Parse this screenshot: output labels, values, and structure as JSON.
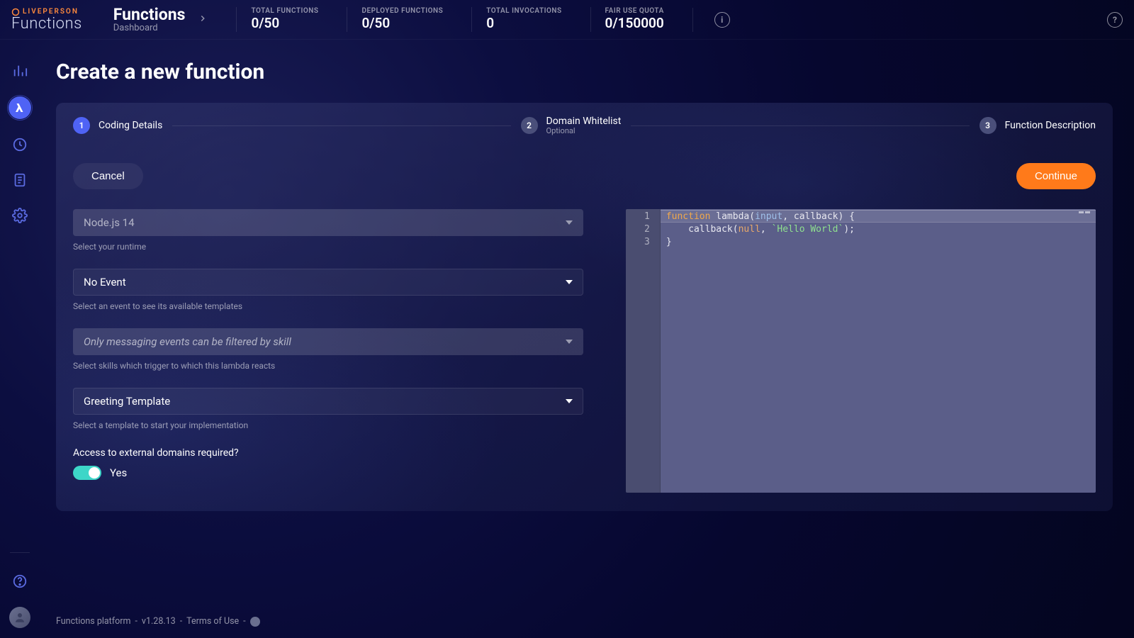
{
  "brand": {
    "lp": "LIVEPERSON",
    "fn": "Functions"
  },
  "breadcrumb": {
    "title": "Functions",
    "subtitle": "Dashboard"
  },
  "stats": {
    "total_functions": {
      "label": "TOTAL FUNCTIONS",
      "value": "0/50"
    },
    "deployed_functions": {
      "label": "DEPLOYED FUNCTIONS",
      "value": "0/50"
    },
    "total_invocations": {
      "label": "TOTAL INVOCATIONS",
      "value": "0"
    },
    "fair_use_quota": {
      "label": "FAIR USE QUOTA",
      "value": "0/150000"
    }
  },
  "page": {
    "title": "Create a new function"
  },
  "stepper": {
    "s1": {
      "num": "1",
      "title": "Coding Details"
    },
    "s2": {
      "num": "2",
      "title": "Domain Whitelist",
      "sub": "Optional"
    },
    "s3": {
      "num": "3",
      "title": "Function Description"
    }
  },
  "actions": {
    "cancel": "Cancel",
    "continue": "Continue"
  },
  "form": {
    "runtime": {
      "value": "Node.js 14",
      "helper": "Select your runtime"
    },
    "event": {
      "value": "No Event",
      "helper": "Select an event to see its available templates"
    },
    "skills": {
      "placeholder": "Only messaging events can be filtered by skill",
      "helper": "Select skills which trigger to which this lambda reacts"
    },
    "template": {
      "value": "Greeting Template",
      "helper": "Select a template to start your implementation"
    },
    "external": {
      "label": "Access to external domains required?",
      "value": "Yes"
    }
  },
  "code": {
    "gutter": [
      "1",
      "2",
      "3"
    ],
    "l1": {
      "kw": "function",
      "fn": " lambda",
      "open": "(",
      "a1": "input",
      "c1": ", ",
      "a2": "callback",
      "close": ") {"
    },
    "l2": {
      "indent": "    ",
      "call": "callback(",
      "nul": "null",
      "c": ", ",
      "str": "`Hello World`",
      "end": ");"
    },
    "l3": {
      "brace": "}"
    }
  },
  "footer": {
    "platform": "Functions platform",
    "dash1": " - ",
    "version": "v1.28.13",
    "dash2": " - ",
    "terms": "Terms of Use",
    "dash3": " - "
  }
}
